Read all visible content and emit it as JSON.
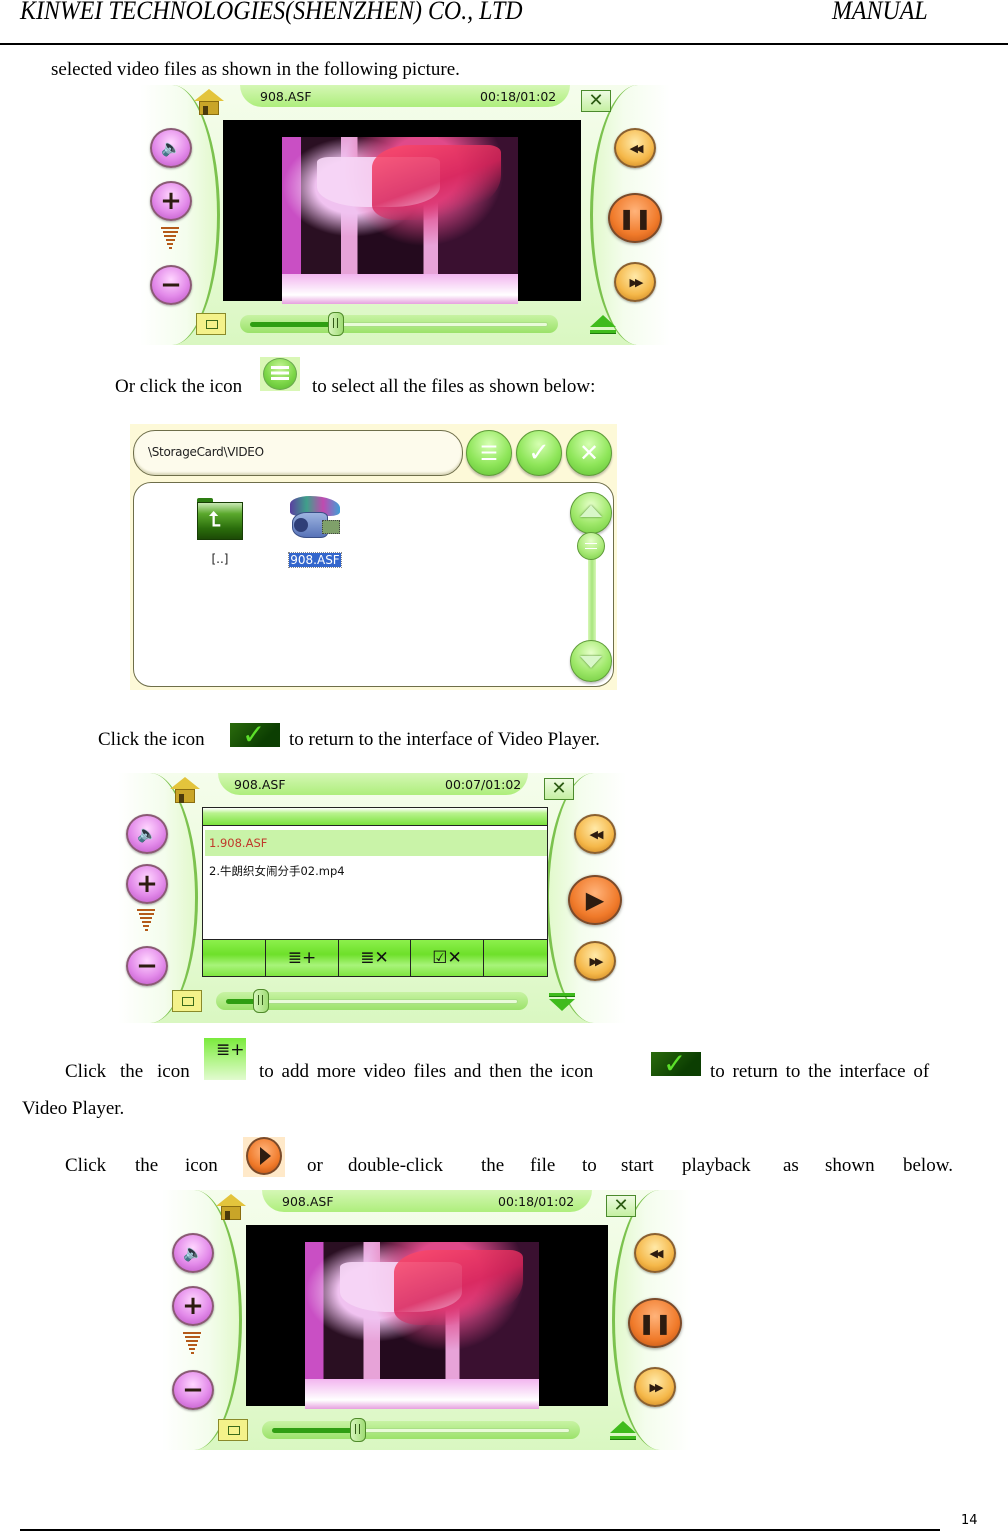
{
  "header": {
    "company": "KINWEI TECHNOLOGIES(SHENZHEN) CO., LTD",
    "doc_type": "MANUAL"
  },
  "paragraphs": {
    "p1": "selected video files as shown in the following picture.",
    "p2_before": "Or click the icon",
    "p2_after": "to select all the files as shown below:",
    "p3_before": "Click the icon",
    "p3_after": "to return to the interface of Video Player.",
    "p4_w1": "Click",
    "p4_w2": "the",
    "p4_w3": "icon",
    "p4_mid": "to add more video files and then the icon",
    "p4_end": "to return to the interface of",
    "p4_line2": "Video Player.",
    "p5_words": [
      "Click",
      "the",
      "icon",
      "or",
      "double-click",
      "the",
      "file",
      "to",
      "start",
      "playback",
      "as",
      "shown",
      "below."
    ]
  },
  "icons": {
    "select_all": "list-icon",
    "confirm": "check-icon",
    "add_to_playlist": "add-list-icon",
    "play": "play-icon"
  },
  "player1": {
    "filename": "908.ASF",
    "time": "00:18/01:02",
    "close_glyph": "✕",
    "progress": 0.29,
    "state": "playing"
  },
  "browser": {
    "path": "\\StorageCard\\VIDEO",
    "items": [
      {
        "label": "[..]",
        "type": "parent-folder",
        "selected": false
      },
      {
        "label": "908.ASF",
        "type": "video-file",
        "selected": true
      }
    ],
    "buttons": {
      "select_all": "☰",
      "ok": "✓",
      "cancel": "✕"
    }
  },
  "player2": {
    "filename": "908.ASF",
    "time": "00:07/01:02",
    "close_glyph": "✕",
    "progress": 0.12,
    "state": "paused",
    "playlist": [
      {
        "label": "1.908.ASF",
        "selected": true
      },
      {
        "label": "2.牛朗织女闹分手02.mp4",
        "selected": false
      }
    ],
    "toolbar": [
      "",
      "≣+",
      "≣✕",
      "☑✕",
      ""
    ]
  },
  "player3": {
    "filename": "908.ASF",
    "time": "00:18/01:02",
    "close_glyph": "✕",
    "progress": 0.29,
    "state": "playing"
  },
  "glyphs": {
    "mute": "🔈",
    "plus": "+",
    "minus": "−",
    "rewind": "◀◀",
    "forward": "▶▶",
    "pause": "❚❚",
    "play": "▶"
  },
  "footer": {
    "page_number": "14"
  },
  "colors": {
    "skin_green": "#7cc24e",
    "selection_blue": "#3366cc",
    "playlist_selected_text": "#c0392b"
  }
}
